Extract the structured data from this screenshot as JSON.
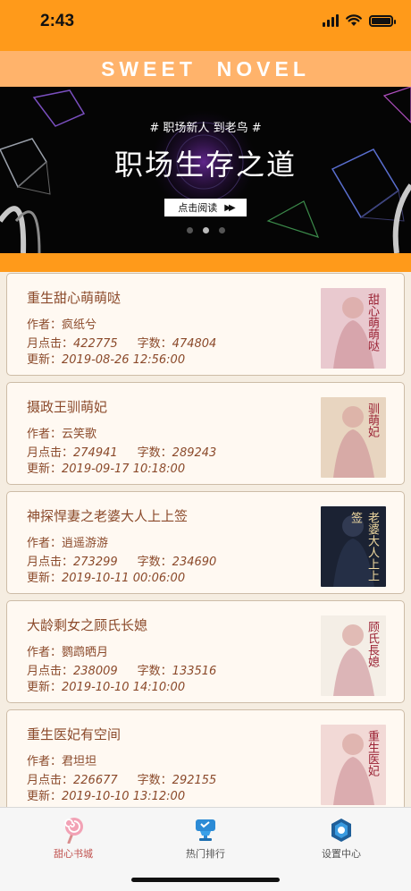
{
  "status_bar": {
    "time": "2:43"
  },
  "header": {
    "brand_title": "SWEET  NOVEL"
  },
  "banner": {
    "tag": "# 职场新人 到老鸟 #",
    "title": "职场生存之道",
    "button_label": "点击阅读",
    "page_count": 3,
    "active_page": 2
  },
  "labels": {
    "author_prefix": "作者：",
    "clicks_prefix": "月点击：",
    "words_prefix": "字数：",
    "updated_prefix": "更新："
  },
  "books": [
    {
      "title": "重生甜心萌萌哒",
      "author": "疯纸兮",
      "monthly_clicks": "422775",
      "word_count": "474804",
      "updated": "2019-08-26 12:56:00",
      "cover_text": "甜心萌萌哒",
      "cover_color": "#E9C9CF"
    },
    {
      "title": "摄政王驯萌妃",
      "author": "云笑歌",
      "monthly_clicks": "274941",
      "word_count": "289243",
      "updated": "2019-09-17 10:18:00",
      "cover_text": "驯萌妃",
      "cover_color": "#E8D5C0"
    },
    {
      "title": "神探悍妻之老婆大人上上签",
      "author": "逍遥游游",
      "monthly_clicks": "273299",
      "word_count": "234690",
      "updated": "2019-10-11 00:06:00",
      "cover_text": "老婆大人上上签",
      "cover_color": "#1B2233"
    },
    {
      "title": "大龄剩女之顾氏长媳",
      "author": "鹦鹉晒月",
      "monthly_clicks": "238009",
      "word_count": "133516",
      "updated": "2019-10-10 14:10:00",
      "cover_text": "顾氏長媳",
      "cover_color": "#F4EEE6"
    },
    {
      "title": "重生医妃有空间",
      "author": "君坦坦",
      "monthly_clicks": "226677",
      "word_count": "292155",
      "updated": "2019-10-10 13:12:00",
      "cover_text": "重生医妃",
      "cover_color": "#F2D9D6"
    }
  ],
  "tabs": [
    {
      "label": "甜心书城",
      "icon": "lollipop-icon",
      "active": true,
      "color": "#C0504D"
    },
    {
      "label": "热门排行",
      "icon": "trophy-icon",
      "active": false,
      "color": "#555555"
    },
    {
      "label": "设置中心",
      "icon": "settings-badge-icon",
      "active": false,
      "color": "#555555"
    }
  ],
  "colors": {
    "accent_orange": "#FF9A1A",
    "brand_bar": "#FFB36B",
    "card_text": "#8B4A2B",
    "list_background": "#F5EDE1"
  }
}
